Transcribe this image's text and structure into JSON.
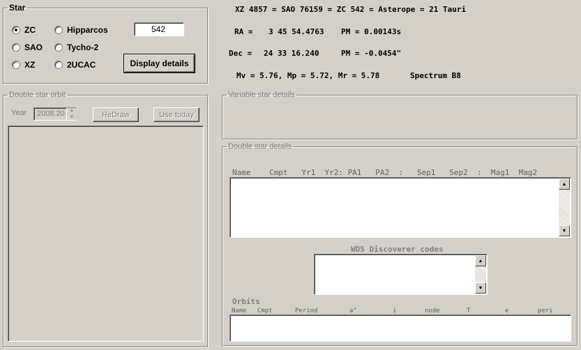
{
  "star_group": {
    "legend": "Star",
    "catalogs": [
      {
        "label": "ZC",
        "selected": true
      },
      {
        "label": "SAO",
        "selected": false
      },
      {
        "label": "XZ",
        "selected": false
      },
      {
        "label": "Hipparcos",
        "selected": false
      },
      {
        "label": "Tycho-2",
        "selected": false
      },
      {
        "label": "2UCAC",
        "selected": false
      }
    ],
    "number_value": "542",
    "display_button": "Display details"
  },
  "star_info": {
    "line1": "XZ 4857 = SAO 76159 = ZC 542 = Asterope = 21 Tauri",
    "ra_label": "RA =",
    "ra_value": "3 45 54.4763",
    "ra_pm": "PM = 0.00143s",
    "dec_label": "Dec =",
    "dec_value": "24 33 16.240",
    "dec_pm": "PM = -0.0454\"",
    "mags": "Mv = 5.76, Mp = 5.72, Mr = 5.78",
    "spectrum": "Spectrum B8"
  },
  "orbit_group": {
    "legend": "Double star orbit",
    "year_label": "Year",
    "year_value": "2008.20",
    "redraw_button": "ReDraw",
    "use_today_button": "Use today"
  },
  "variable_group": {
    "legend": "Variable star details"
  },
  "double_group": {
    "legend": "Double star details",
    "columns_header": "Name    Cmpt   Yr1  Yr2: PA1   PA2  :   Sep1   Sep2  :  Mag1  Mag2",
    "wds_label": "WDS Discoverer codes",
    "orbits_label": "Orbits",
    "orbits_columns": [
      "Name",
      "Cmpt",
      "Period",
      "a\"",
      "i",
      "node",
      "T",
      "e",
      "peri"
    ]
  },
  "icons": {
    "scroll_up": "up-arrow-icon",
    "scroll_down": "down-arrow-icon"
  }
}
